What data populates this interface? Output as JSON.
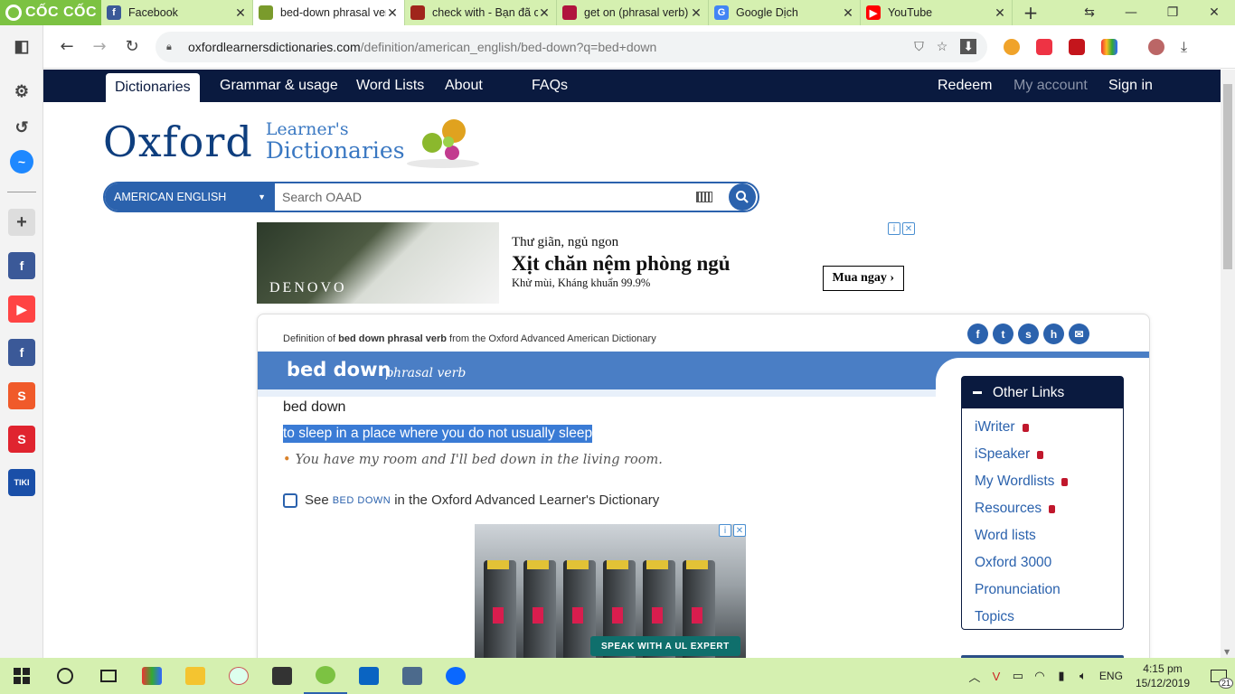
{
  "browser": {
    "brand": "CỐC CỐC",
    "tabs": [
      {
        "title": "Facebook",
        "icon": "facebook-icon",
        "color": "#3b5998",
        "glyph": "f",
        "active": false
      },
      {
        "title": "bed-down phrasal verb",
        "icon": "oxford-icon",
        "color": "#7a9b2c",
        "glyph": "",
        "active": true
      },
      {
        "title": "check with - Bạn đã c",
        "icon": "cambridge-icon",
        "color": "#a0251c",
        "glyph": "",
        "active": false
      },
      {
        "title": "get on (phrasal verb)",
        "icon": "macmillan-icon",
        "color": "#b0153e",
        "glyph": "",
        "active": false
      },
      {
        "title": "Google Dịch",
        "icon": "google-translate-icon",
        "color": "#4285f4",
        "glyph": "G",
        "active": false
      },
      {
        "title": "YouTube",
        "icon": "youtube-icon",
        "color": "#ff0000",
        "glyph": "▶",
        "active": false
      }
    ],
    "url_host": "oxfordlearnersdictionaries.com",
    "url_path": "/definition/american_english/bed-down?q=bed+down"
  },
  "site": {
    "nav": [
      "Dictionaries",
      "Grammar & usage",
      "Word Lists",
      "About",
      "FAQs"
    ],
    "nav_right": [
      "Redeem",
      "My account",
      "Sign in"
    ],
    "logo_main": "Oxford",
    "logo_sub1": "Learner's",
    "logo_sub2": "Dictionaries",
    "dict_select": "AMERICAN ENGLISH",
    "search_placeholder": "Search OAAD"
  },
  "ad1": {
    "brand": "DENOVO",
    "line1": "Thư giãn, ngủ ngon",
    "line2": "Xịt chăn nệm phòng ngủ",
    "line3": "Khử mùi, Kháng khuẩn 99.9%",
    "cta": "Mua ngay"
  },
  "entry": {
    "def_of_prefix": "Definition of",
    "def_of_term": "bed down phrasal verb",
    "def_of_suffix": "from the Oxford Advanced American Dictionary",
    "headword": "bed down",
    "pos": "phrasal verb",
    "sub_headword": "bed down",
    "definition": "to sleep in a place where you do not usually sleep",
    "example": "You have my room and I'll bed down in the living room.",
    "see_prefix": "See",
    "see_term": "BED DOWN",
    "see_suffix": "in the Oxford Advanced Learner's Dictionary"
  },
  "other_links": {
    "title": "Other Links",
    "items": [
      {
        "label": "iWriter",
        "locked": true
      },
      {
        "label": "iSpeaker",
        "locked": true
      },
      {
        "label": "My Wordlists",
        "locked": true
      },
      {
        "label": "Resources",
        "locked": true
      },
      {
        "label": "Word lists",
        "locked": false
      },
      {
        "label": "Oxford 3000",
        "locked": false
      },
      {
        "label": "Pronunciation",
        "locked": false
      },
      {
        "label": "Topics",
        "locked": false
      }
    ]
  },
  "ad2": {
    "cta": "SPEAK WITH A UL EXPERT"
  },
  "taskbar": {
    "lang": "ENG",
    "time": "4:15 pm",
    "date": "15/12/2019",
    "notif_count": "21"
  },
  "colors": {
    "oxford_blue": "#0a1a3f",
    "link_blue": "#2b62ad",
    "headbar": "#4a7ec5",
    "coccoc_green": "#d5f0b0"
  }
}
